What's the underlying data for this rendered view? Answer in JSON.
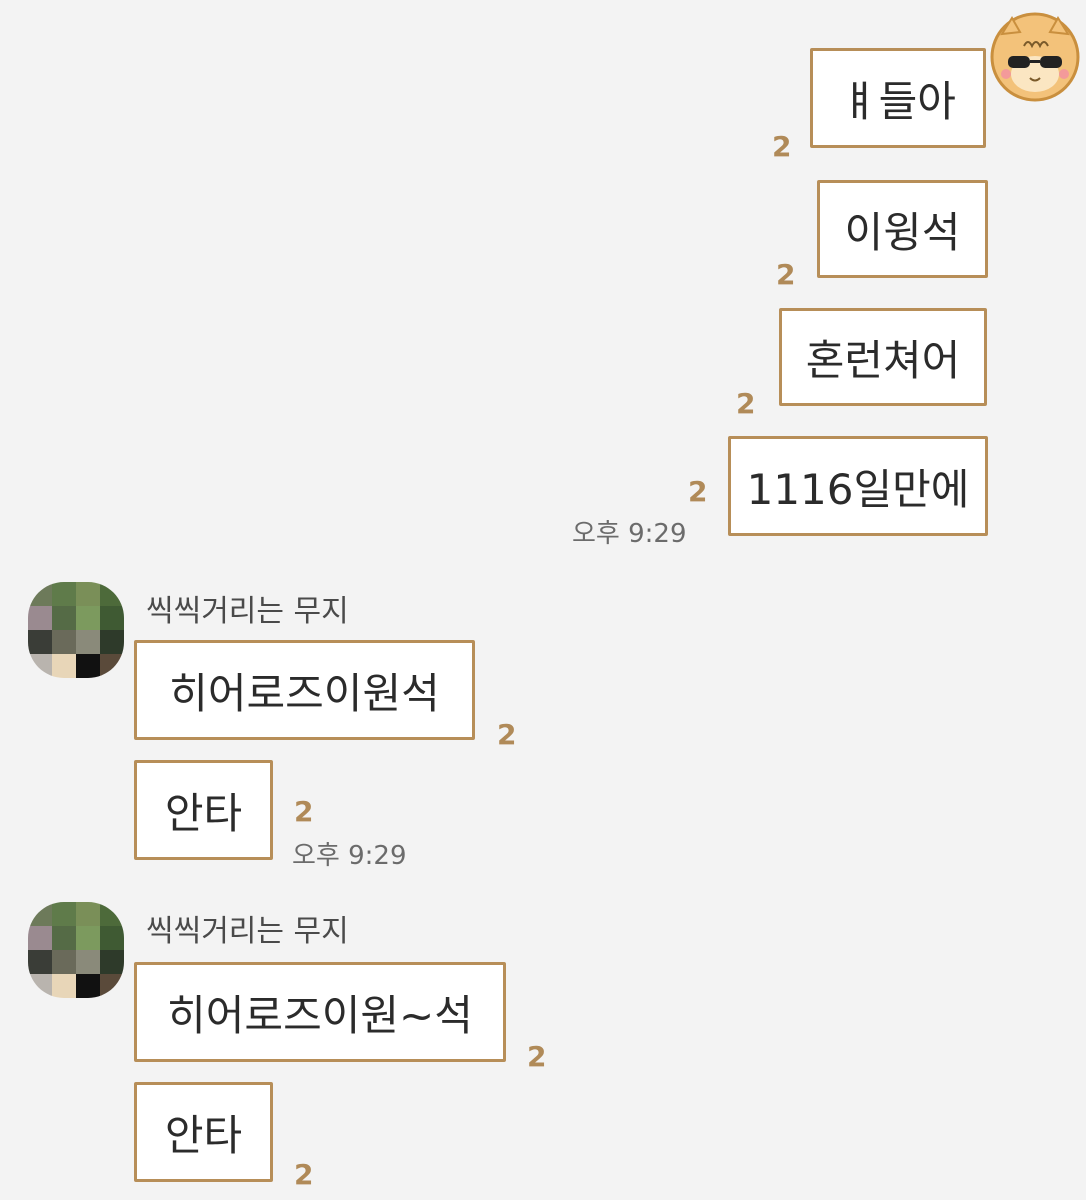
{
  "my_avatar": {
    "icon": "hamster-sunglasses-icon"
  },
  "outgoing": [
    {
      "text": "ㅒ들아",
      "unread": "2"
    },
    {
      "text": "이윙석",
      "unread": "2"
    },
    {
      "text": "혼런쳐어",
      "unread": "2"
    },
    {
      "text": "1116일만에",
      "unread": "2",
      "time": "오후 9:29"
    }
  ],
  "groups": [
    {
      "sender": "씩씩거리는 무지",
      "avatar_icon": "pixelated-avatar-icon",
      "messages": [
        {
          "text": "히어로즈이원석",
          "unread": "2"
        },
        {
          "text": "안타",
          "unread": "2",
          "time": "오후 9:29"
        }
      ]
    },
    {
      "sender": "씩씩거리는 무지",
      "avatar_icon": "pixelated-avatar-icon",
      "messages": [
        {
          "text": "히어로즈이원~석",
          "unread": "2"
        },
        {
          "text": "안타",
          "unread": "2"
        }
      ]
    }
  ],
  "colors": {
    "background": "#f3f3f3",
    "bubble_border": "#b78e58",
    "unread_count": "#b08a58",
    "timestamp": "#6b6b6b"
  }
}
